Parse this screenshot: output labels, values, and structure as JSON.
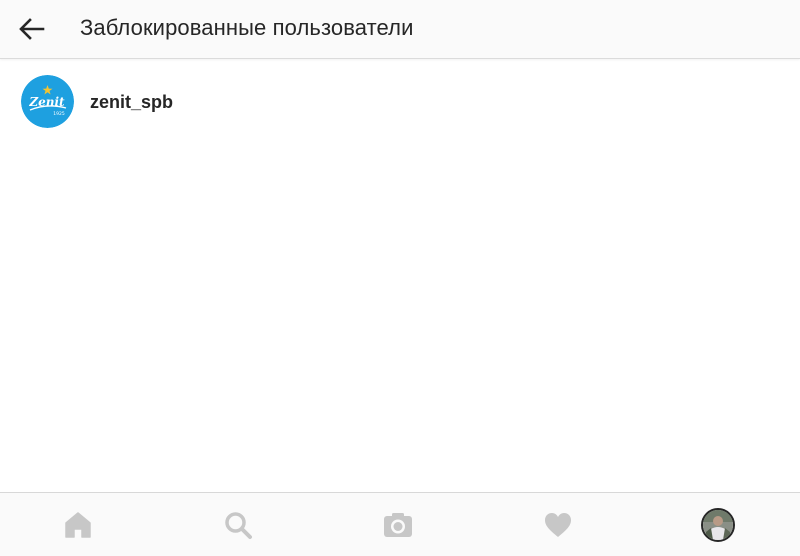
{
  "header": {
    "title": "Заблокированные пользователи",
    "back_icon": "arrow-left-icon"
  },
  "blocked_users": [
    {
      "username": "zenit_spb",
      "avatar_text": "Zenit",
      "avatar_year": "1925",
      "avatar_color": "#1ea0e0"
    }
  ],
  "bottom_nav": {
    "items": [
      {
        "icon": "home-icon"
      },
      {
        "icon": "search-icon"
      },
      {
        "icon": "camera-icon"
      },
      {
        "icon": "heart-icon"
      },
      {
        "icon": "profile-avatar"
      }
    ]
  },
  "colors": {
    "text": "#262626",
    "nav_icon": "#c7c7c7",
    "header_bg": "#fafafa",
    "zenit_blue": "#1ea0e0",
    "star_gold": "#f4c430"
  }
}
